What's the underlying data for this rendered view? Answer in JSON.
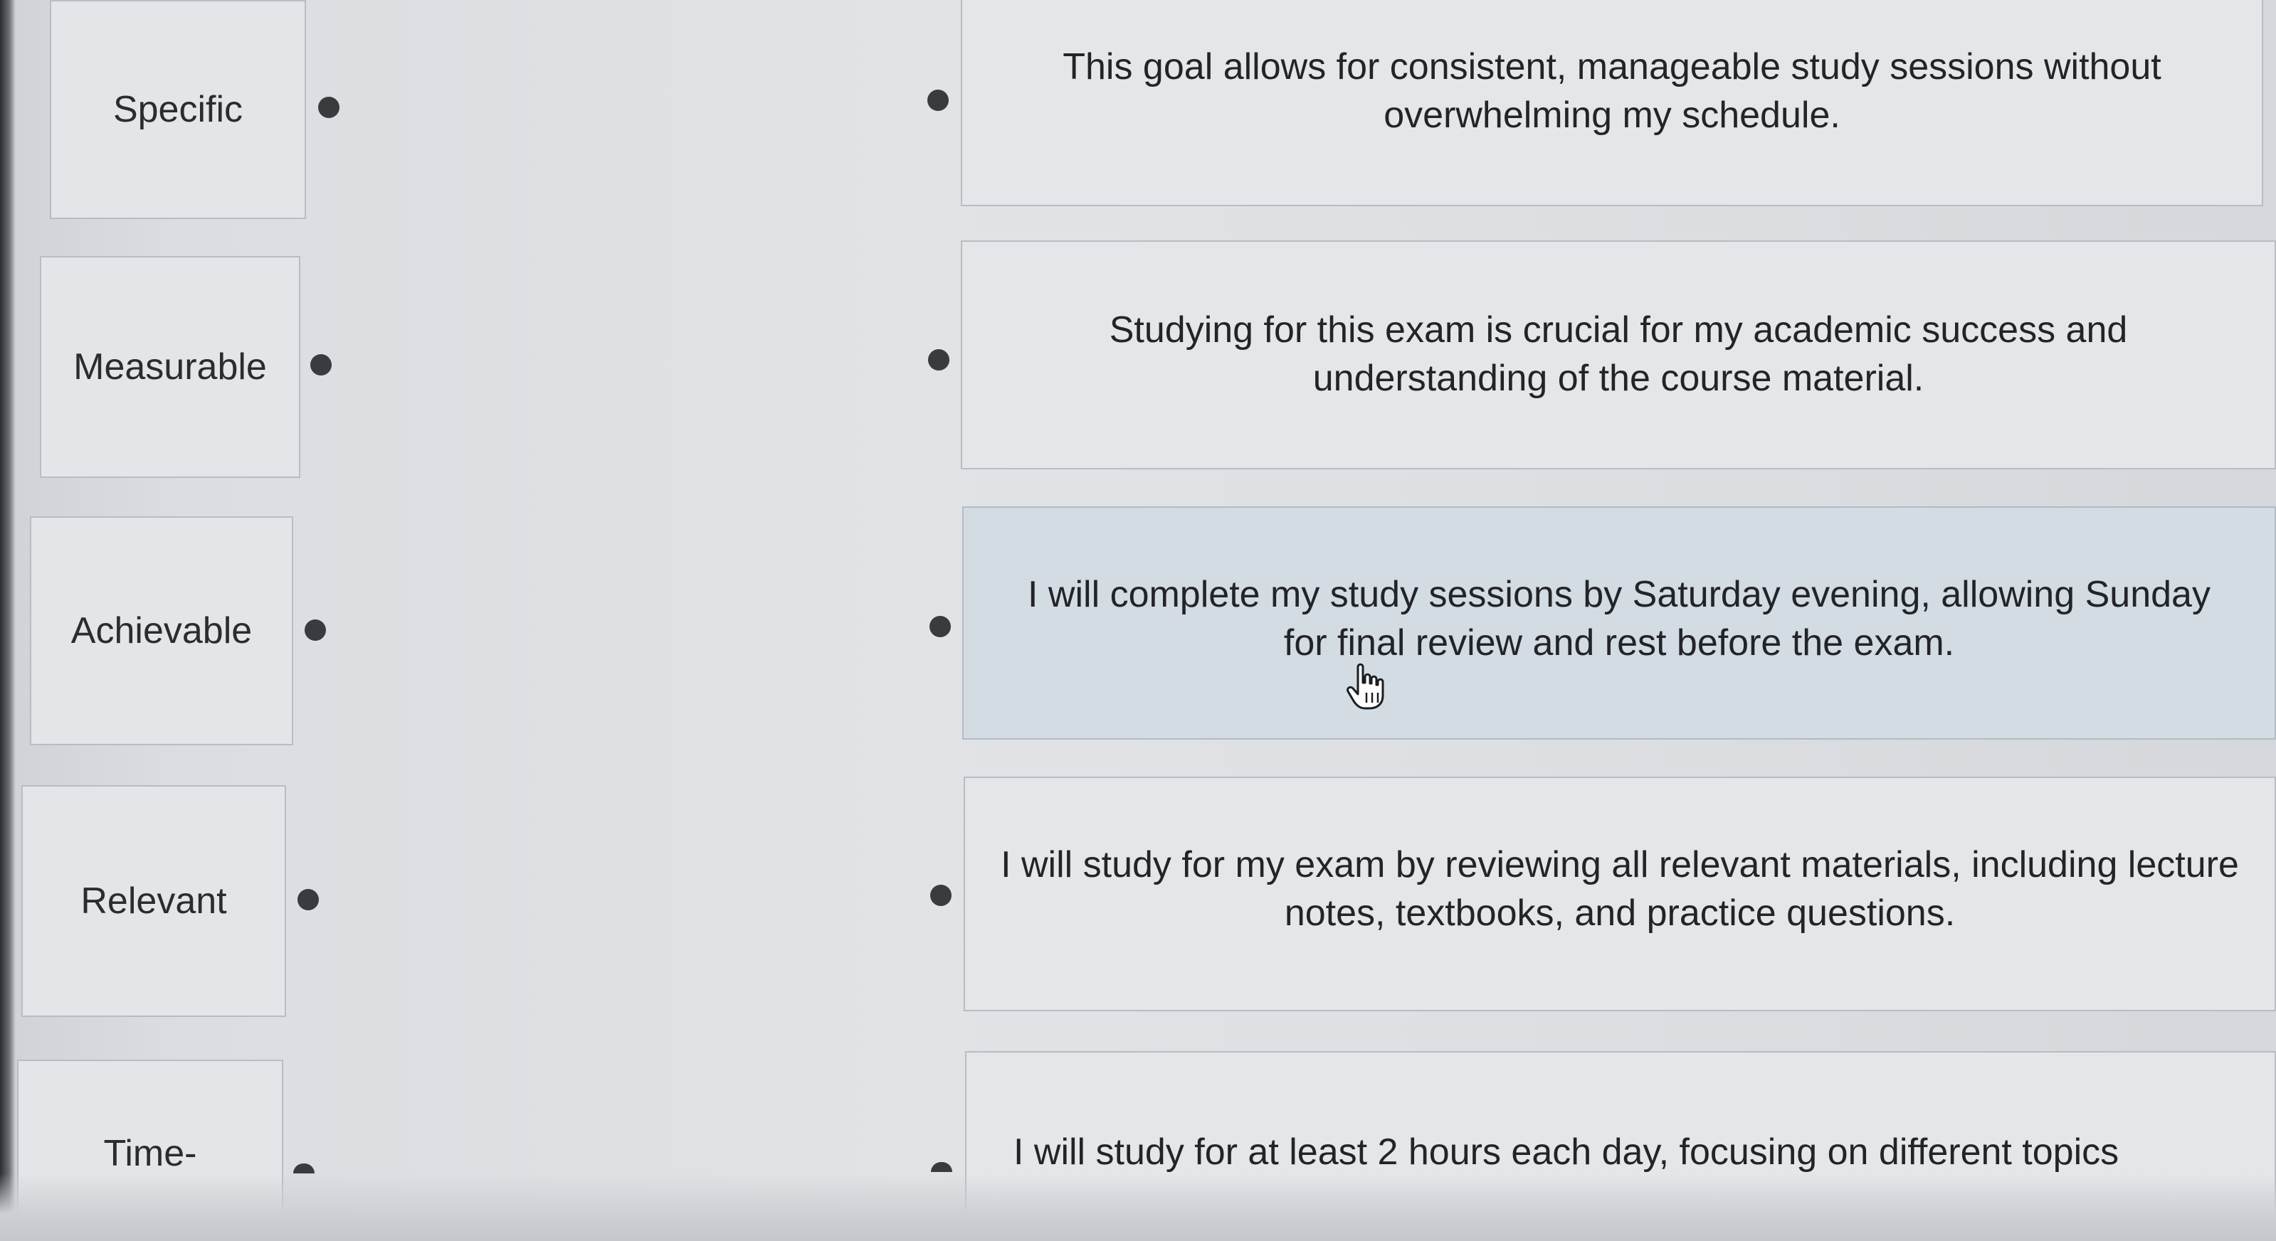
{
  "terms": [
    {
      "label": "Specific"
    },
    {
      "label": "Measurable"
    },
    {
      "label": "Achievable"
    },
    {
      "label": "Relevant"
    },
    {
      "label": "Time-"
    }
  ],
  "descriptions": [
    {
      "text": "This goal allows for consistent, manageable study sessions without overwhelming my schedule."
    },
    {
      "text": "Studying for this exam is crucial for my academic success and understanding of the course material."
    },
    {
      "text": "I will complete my study sessions by Saturday evening, allowing Sunday for final review and rest before the exam."
    },
    {
      "text": "I will study for my exam by reviewing all relevant materials, including lecture notes, textbooks, and practice questions."
    },
    {
      "text": "I will study for at least 2 hours each day, focusing on different topics"
    }
  ],
  "cursor": {
    "icon": "hand-pointer-icon"
  }
}
